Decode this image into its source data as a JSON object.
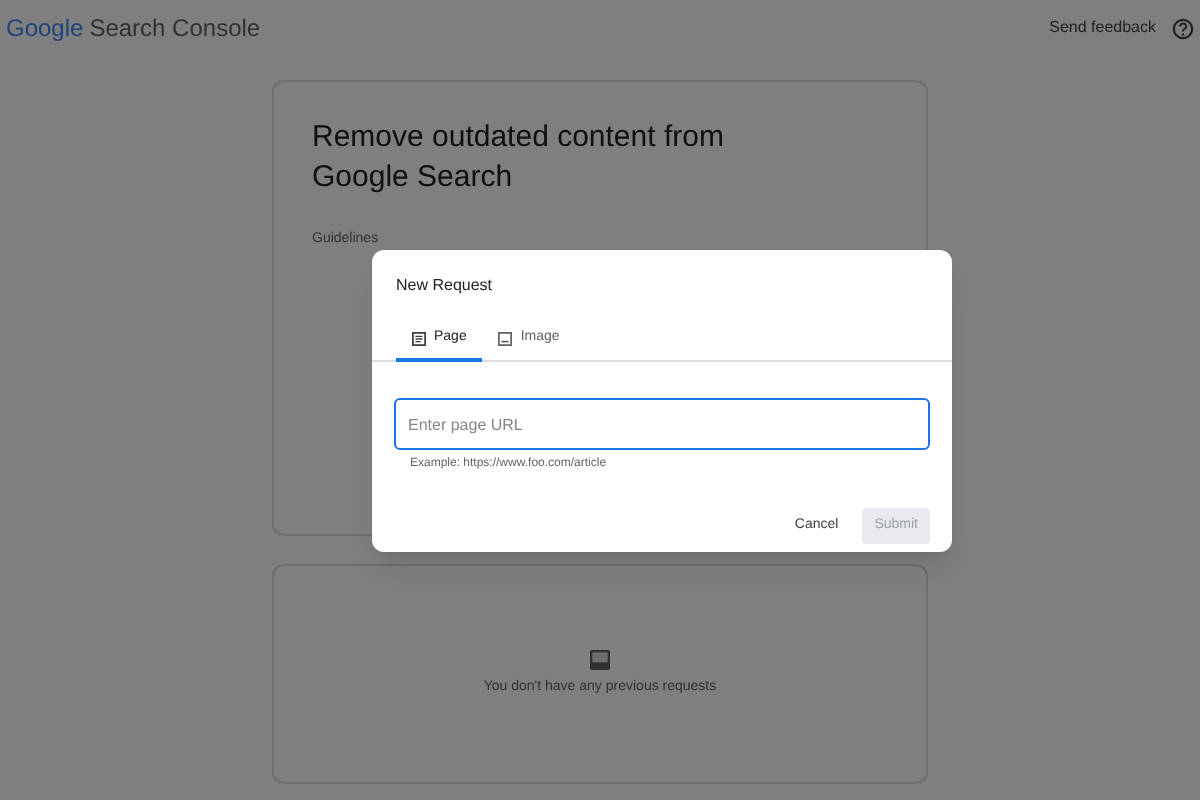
{
  "header": {
    "logo": "Google",
    "product": "Search Console",
    "feedback": "Send feedback"
  },
  "card": {
    "title": "Remove outdated content from Google Search",
    "section": "Guidelines"
  },
  "history": {
    "empty_message": "You don't have any previous requests"
  },
  "dialog": {
    "title": "New Request",
    "tabs": [
      {
        "label": "Page",
        "kind": "page",
        "selected": true
      },
      {
        "label": "Image",
        "kind": "image",
        "selected": false
      }
    ],
    "url_field": {
      "placeholder": "Enter page URL",
      "hint": "Example: https://www.foo.com/article"
    },
    "buttons": [
      {
        "label": "Cancel",
        "kind": "text",
        "disabled": false
      },
      {
        "label": "Submit",
        "kind": "filled",
        "disabled": true
      }
    ]
  }
}
